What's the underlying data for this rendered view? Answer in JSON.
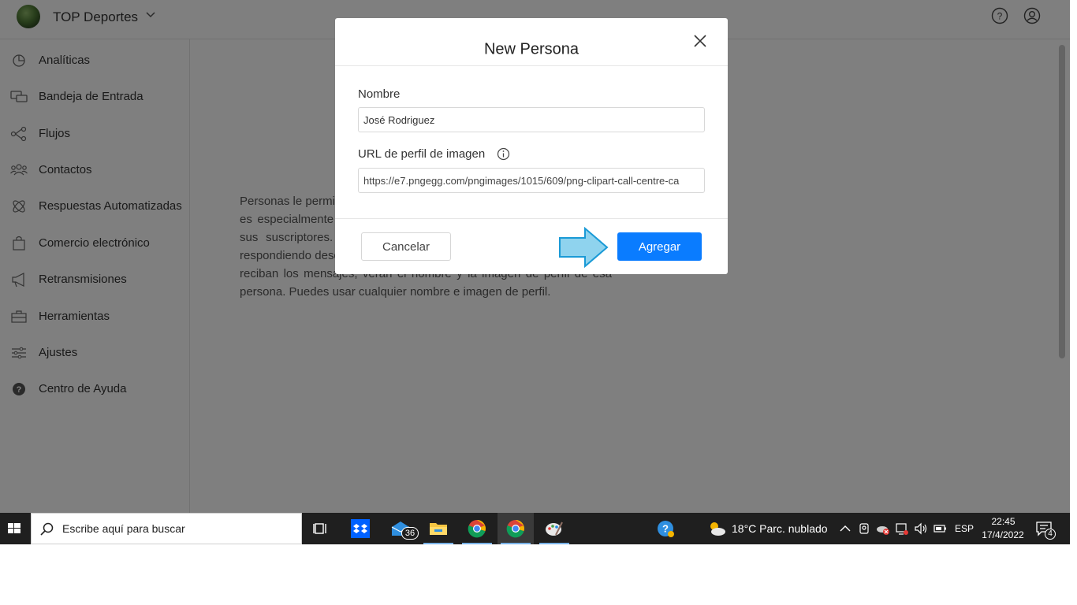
{
  "header": {
    "brand": "TOP Deportes"
  },
  "sidebar": {
    "items": [
      {
        "label": "Analíticas",
        "icon": "pie-chart-icon"
      },
      {
        "label": "Bandeja de Entrada",
        "icon": "chat-bubbles-icon"
      },
      {
        "label": "Flujos",
        "icon": "flow-icon"
      },
      {
        "label": "Contactos",
        "icon": "contacts-icon"
      },
      {
        "label": "Respuestas Automatizadas",
        "icon": "atom-icon"
      },
      {
        "label": "Comercio electrónico",
        "icon": "shopping-bag-icon"
      },
      {
        "label": "Retransmisiones",
        "icon": "megaphone-icon"
      },
      {
        "label": "Herramientas",
        "icon": "toolbox-icon"
      },
      {
        "label": "Ajustes",
        "icon": "sliders-icon"
      },
      {
        "label": "Centro de Ayuda",
        "icon": "help-circle-icon"
      }
    ]
  },
  "main": {
    "description": "Personas le permiten mostrar quién responde en la conversación. Esto es especialmente útil cuando su equipo puede enviar un mensaje a sus suscriptores. Puede crear personas para mostrar quién está respondiendo desde la persona de su equipo. Cuando tus suscriptores reciban los mensajes, verán el nombre y la imagen de perfil de esa persona. Puedes usar cualquier nombre e imagen de perfil."
  },
  "modal": {
    "title": "New Persona",
    "name_label": "Nombre",
    "name_value": "José Rodriguez",
    "url_label": "URL de perfil de imagen",
    "url_value": "https://e7.pngegg.com/pngimages/1015/609/png-clipart-call-centre-ca",
    "cancel_label": "Cancelar",
    "add_label": "Agregar"
  },
  "taskbar": {
    "search_placeholder": "Escribe aquí para buscar",
    "mail_badge": "36",
    "weather": "18°C  Parc. nublado",
    "language": "ESP",
    "time": "22:45",
    "date": "17/4/2022",
    "notification_count": "4"
  },
  "colors": {
    "accent": "#0a7cff",
    "overlay": "rgba(0,0,0,0.5)",
    "taskbar": "#1f1f1f",
    "pointer_arrow": "#8fd3ee"
  }
}
